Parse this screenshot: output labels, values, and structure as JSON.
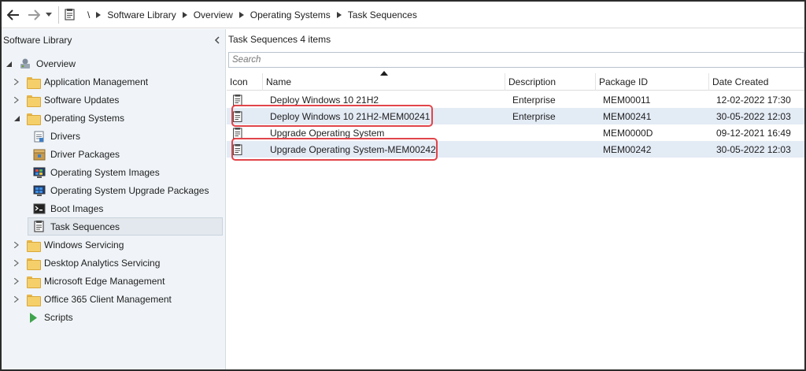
{
  "breadcrumb": {
    "separator": "\\",
    "items": [
      "Software Library",
      "Overview",
      "Operating Systems",
      "Task Sequences"
    ]
  },
  "nav": {
    "title": "Software Library",
    "root": "Overview",
    "items": [
      {
        "label": "Application Management",
        "icon": "folder-icon"
      },
      {
        "label": "Software Updates",
        "icon": "folder-icon"
      },
      {
        "label": "Operating Systems",
        "icon": "folder-icon"
      },
      {
        "label": "Drivers",
        "icon": "driver-icon"
      },
      {
        "label": "Driver Packages",
        "icon": "driver-package-icon"
      },
      {
        "label": "Operating System Images",
        "icon": "os-image-icon"
      },
      {
        "label": "Operating System Upgrade Packages",
        "icon": "os-upgrade-package-icon"
      },
      {
        "label": "Boot Images",
        "icon": "boot-image-icon"
      },
      {
        "label": "Task Sequences",
        "icon": "task-sequence-icon"
      },
      {
        "label": "Windows Servicing",
        "icon": "folder-icon"
      },
      {
        "label": "Desktop Analytics Servicing",
        "icon": "folder-icon"
      },
      {
        "label": "Microsoft Edge Management",
        "icon": "folder-icon"
      },
      {
        "label": "Office 365 Client Management",
        "icon": "folder-icon"
      },
      {
        "label": "Scripts",
        "icon": "script-icon"
      }
    ]
  },
  "main": {
    "title": "Task Sequences 4 items",
    "search_placeholder": "Search",
    "columns": [
      "Icon",
      "Name",
      "Description",
      "Package ID",
      "Date Created"
    ],
    "rows": [
      {
        "name": "Deploy Windows 10 21H2",
        "description": "Enterprise",
        "package_id": "MEM00011",
        "date_created": "12-02-2022 17:30"
      },
      {
        "name": "Deploy Windows 10 21H2-MEM00241",
        "description": "Enterprise",
        "package_id": "MEM00241",
        "date_created": "30-05-2022 12:03"
      },
      {
        "name": "Upgrade Operating System",
        "description": "",
        "package_id": "MEM0000D",
        "date_created": "09-12-2021 16:49"
      },
      {
        "name": "Upgrade Operating System-MEM00242",
        "description": "",
        "package_id": "MEM00242",
        "date_created": "30-05-2022 12:03"
      }
    ]
  },
  "colors": {
    "highlight_box": "#e0454a",
    "nav_background": "#f0f4f8",
    "selected_row": "#e3ebf5"
  }
}
